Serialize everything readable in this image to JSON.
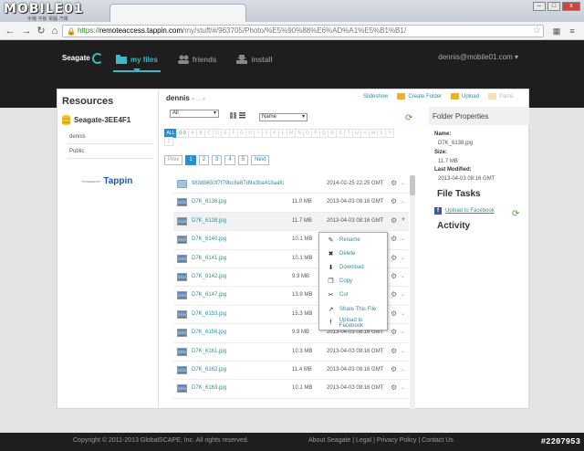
{
  "browser": {
    "tab_title": "",
    "site_logo": "MOBILE01",
    "site_logo_sub": "手機 平板 電腦 汽車",
    "url_scheme": "https://",
    "url_host": "remoteaccess.tappin.com",
    "url_path": "/my/stuff/#/963705/Photo/%E5%90%88%E6%AD%A1%E5%B1%B1/",
    "window_buttons": [
      "–",
      "□",
      "x"
    ]
  },
  "header": {
    "brand": "Seagate",
    "nav": [
      {
        "label": "my files",
        "icon": "folder-icon",
        "active": true
      },
      {
        "label": "friends",
        "icon": "friends-icon",
        "active": false
      },
      {
        "label": "install",
        "icon": "install-icon",
        "active": false
      }
    ],
    "user": "dennis@mobile01.com"
  },
  "resources": {
    "title": "Resources",
    "drive": "Seagate-3EE4F1",
    "items": [
      "dennis",
      "Public"
    ],
    "powered_by": "POWERED BY",
    "tappin": "Tappin"
  },
  "files": {
    "breadcrumb": "dennis",
    "breadcrumb_sep": "» ... »",
    "actions": {
      "slideshow": "Slideshow",
      "create_folder": "Create Folder",
      "upload": "Upload",
      "paste": "Paste"
    },
    "filter": "All",
    "sort": "Name",
    "alphabet": [
      "ALL",
      "0-9",
      "A",
      "B",
      "C",
      "D",
      "E",
      "F",
      "G",
      "H",
      "I",
      "J",
      "K",
      "L",
      "M",
      "N",
      "O",
      "P",
      "Q",
      "R",
      "S",
      "T",
      "U",
      "V",
      "W",
      "X",
      "Y",
      "Z"
    ],
    "pager": [
      "Prev",
      "1",
      "2",
      "3",
      "4",
      "5",
      "Next"
    ],
    "rows": [
      {
        "name": "983db650f7f79bc8e87d9a3ba418aafc",
        "size": "",
        "date": "2014-02-25 22:25 GMT",
        "folder": true
      },
      {
        "name": "D7K_6136.jpg",
        "size": "11.0 MB",
        "date": "2013-04-03 08:16 GMT"
      },
      {
        "name": "D7K_6138.jpg",
        "size": "11.7 MB",
        "date": "2013-04-03 08:16 GMT"
      },
      {
        "name": "D7K_6140.jpg",
        "size": "10.1 MB",
        "date": "2013-04-03 08:16 GMT"
      },
      {
        "name": "D7K_6141.jpg",
        "size": "10.1 MB",
        "date": "2013-04-03 08:16 GMT"
      },
      {
        "name": "D7K_6142.jpg",
        "size": "9.9 MB",
        "date": "2013-04-03 08:16 GMT"
      },
      {
        "name": "D7K_6147.jpg",
        "size": "13.9 MB",
        "date": "2013-04-03 08:16 GMT"
      },
      {
        "name": "D7K_6153.jpg",
        "size": "15.3 MB",
        "date": "2013-04-03 08:16 GMT"
      },
      {
        "name": "D7K_6156.jpg",
        "size": "9.9 MB",
        "date": "2013-04-03 08:16 GMT"
      },
      {
        "name": "D7K_6161.jpg",
        "size": "10.3 MB",
        "date": "2013-04-03 08:16 GMT"
      },
      {
        "name": "D7K_6162.jpg",
        "size": "11.4 MB",
        "date": "2013-04-03 08:16 GMT"
      },
      {
        "name": "D7K_6163.jpg",
        "size": "10.1 MB",
        "date": "2013-04-03 08:16 GMT"
      }
    ]
  },
  "context_menu": [
    {
      "label": "Rename",
      "icon": "rename-icon",
      "glyph": "✎"
    },
    {
      "label": "Delete",
      "icon": "delete-icon",
      "glyph": "✖"
    },
    {
      "label": "Download",
      "icon": "download-icon",
      "glyph": "⬇"
    },
    {
      "label": "Copy",
      "icon": "copy-icon",
      "glyph": "❐"
    },
    {
      "label": "Cut",
      "icon": "cut-icon",
      "glyph": "✂"
    },
    {
      "label": "Share This File",
      "icon": "share-icon",
      "glyph": "↗"
    },
    {
      "label": "Upload to Facebook",
      "icon": "facebook-icon",
      "glyph": "f"
    }
  ],
  "properties": {
    "title": "Folder Properties",
    "name_label": "Name:",
    "name": "D7K_6138.jpg",
    "size_label": "Size:",
    "size": "11.7 MB",
    "modified_label": "Last Modified:",
    "modified": "2013-04-03 08:16 GMT",
    "tasks_title": "File Tasks",
    "fb_link": "Upload to Facebook",
    "activity_title": "Activity"
  },
  "footer": {
    "copyright": "Copyright © 2011-2013 GlobalSCAPE, Inc. All rights reserved.",
    "links": "About Seagate | Legal | Privacy Policy | Contact Us",
    "watermark": "#2207953"
  },
  "colors": {
    "accent": "#3fb7c6",
    "link": "#2f8f9b",
    "blue": "#2a8fd0"
  }
}
